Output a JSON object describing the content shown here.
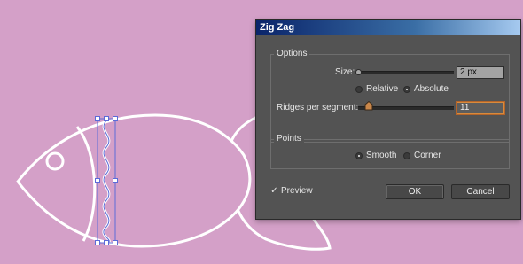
{
  "dialog": {
    "title": "Zig Zag",
    "options": {
      "legend": "Options",
      "size_label": "Size:",
      "size_value": "2 px",
      "size_slider_level": 0.0,
      "size_mode_options": [
        "Relative",
        "Absolute"
      ],
      "size_mode_selected": "Absolute",
      "ridges_label": "Ridges per segment:",
      "ridges_value": "11",
      "ridges_slider_level": 0.11
    },
    "points": {
      "legend": "Points",
      "options": [
        "Smooth",
        "Corner"
      ],
      "selected": "Smooth"
    },
    "preview": {
      "label": "Preview",
      "checked": true,
      "check_glyph": "✓"
    },
    "buttons": {
      "ok": "OK",
      "cancel": "Cancel"
    }
  },
  "colors": {
    "artboard": "#d4a0c8",
    "artwork_stroke": "#ffffff",
    "selection": "#5b6bd8",
    "dialog_bg": "#535353",
    "focus_ring": "#d88a3c"
  },
  "icons": [
    "checkmark-icon",
    "slider-knob-icon"
  ]
}
